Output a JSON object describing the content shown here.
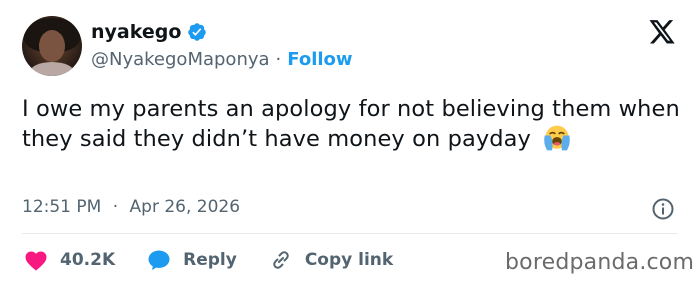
{
  "author": {
    "display_name": "nyakego",
    "handle": "@NyakegoMaponya",
    "separator": "·",
    "follow_label": "Follow"
  },
  "tweet": {
    "text": "I owe my parents an apology for not believing them when they said they didn’t have money on payday",
    "emoji": "loudly-crying-face",
    "time": "12:51 PM",
    "separator": "·",
    "date": "Apr 26, 2026"
  },
  "actions": {
    "likes": "40.2K",
    "reply_label": "Reply",
    "copy_link_label": "Copy link"
  },
  "watermark": "boredpanda.com",
  "colors": {
    "verified": "#1d9bf0",
    "like": "#f91880",
    "reply": "#1d9bf0",
    "follow": "#1d9bf0",
    "secondary_text": "#536471"
  },
  "icons": [
    "verified-badge-icon",
    "x-logo-icon",
    "info-icon",
    "heart-icon",
    "reply-bubble-icon",
    "link-icon"
  ]
}
